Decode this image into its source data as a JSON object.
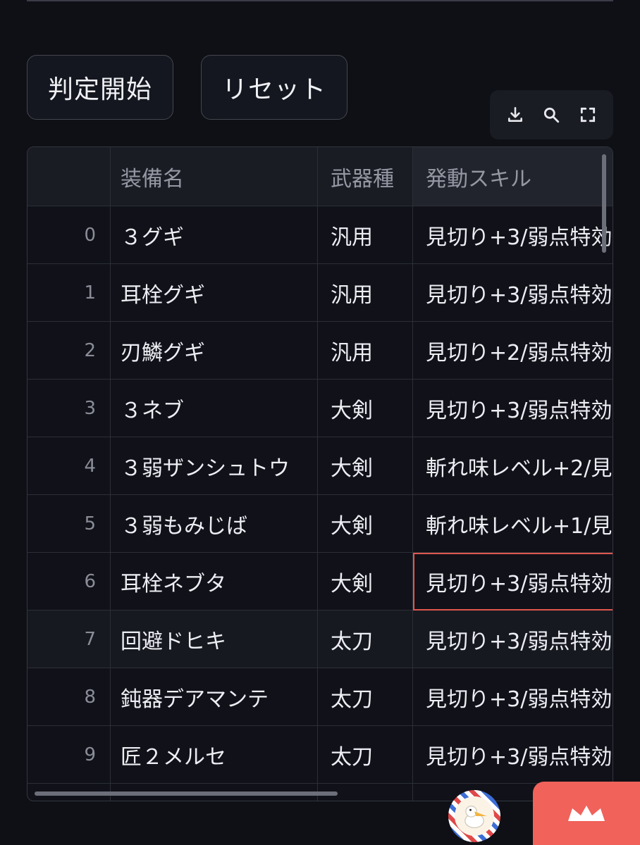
{
  "buttons": {
    "start_label": "判定開始",
    "reset_label": "リセット"
  },
  "toolbar": {
    "icons": [
      "download-icon",
      "search-icon",
      "fullscreen-icon"
    ]
  },
  "table": {
    "headers": [
      "",
      "装備名",
      "武器種",
      "発動スキル"
    ],
    "rows": [
      {
        "index": "0",
        "name": "３グギ",
        "type": "汎用",
        "skill": "見切り+3/弱点特効"
      },
      {
        "index": "1",
        "name": "耳栓グギ",
        "type": "汎用",
        "skill": "見切り+3/弱点特効"
      },
      {
        "index": "2",
        "name": "刃鱗グギ",
        "type": "汎用",
        "skill": "見切り+2/弱点特効"
      },
      {
        "index": "3",
        "name": "３ネブ",
        "type": "大剣",
        "skill": "見切り+3/弱点特効"
      },
      {
        "index": "4",
        "name": "３弱ザンシュトウ",
        "type": "大剣",
        "skill": "斬れ味レベル+2/見"
      },
      {
        "index": "5",
        "name": "３弱もみじば",
        "type": "大剣",
        "skill": "斬れ味レベル+1/見"
      },
      {
        "index": "6",
        "name": "耳栓ネブタ",
        "type": "大剣",
        "skill": "見切り+3/弱点特効"
      },
      {
        "index": "7",
        "name": "回避ドヒキ",
        "type": "太刀",
        "skill": "見切り+3/弱点特効"
      },
      {
        "index": "8",
        "name": "鈍器デアマンテ",
        "type": "太刀",
        "skill": "見切り+3/弱点特効"
      },
      {
        "index": "9",
        "name": "匠２メルセ",
        "type": "太刀",
        "skill": "見切り+3/弱点特効"
      }
    ]
  },
  "colors": {
    "accent": "#f0625a",
    "selection": "#e0584f",
    "background": "#0f1016"
  }
}
